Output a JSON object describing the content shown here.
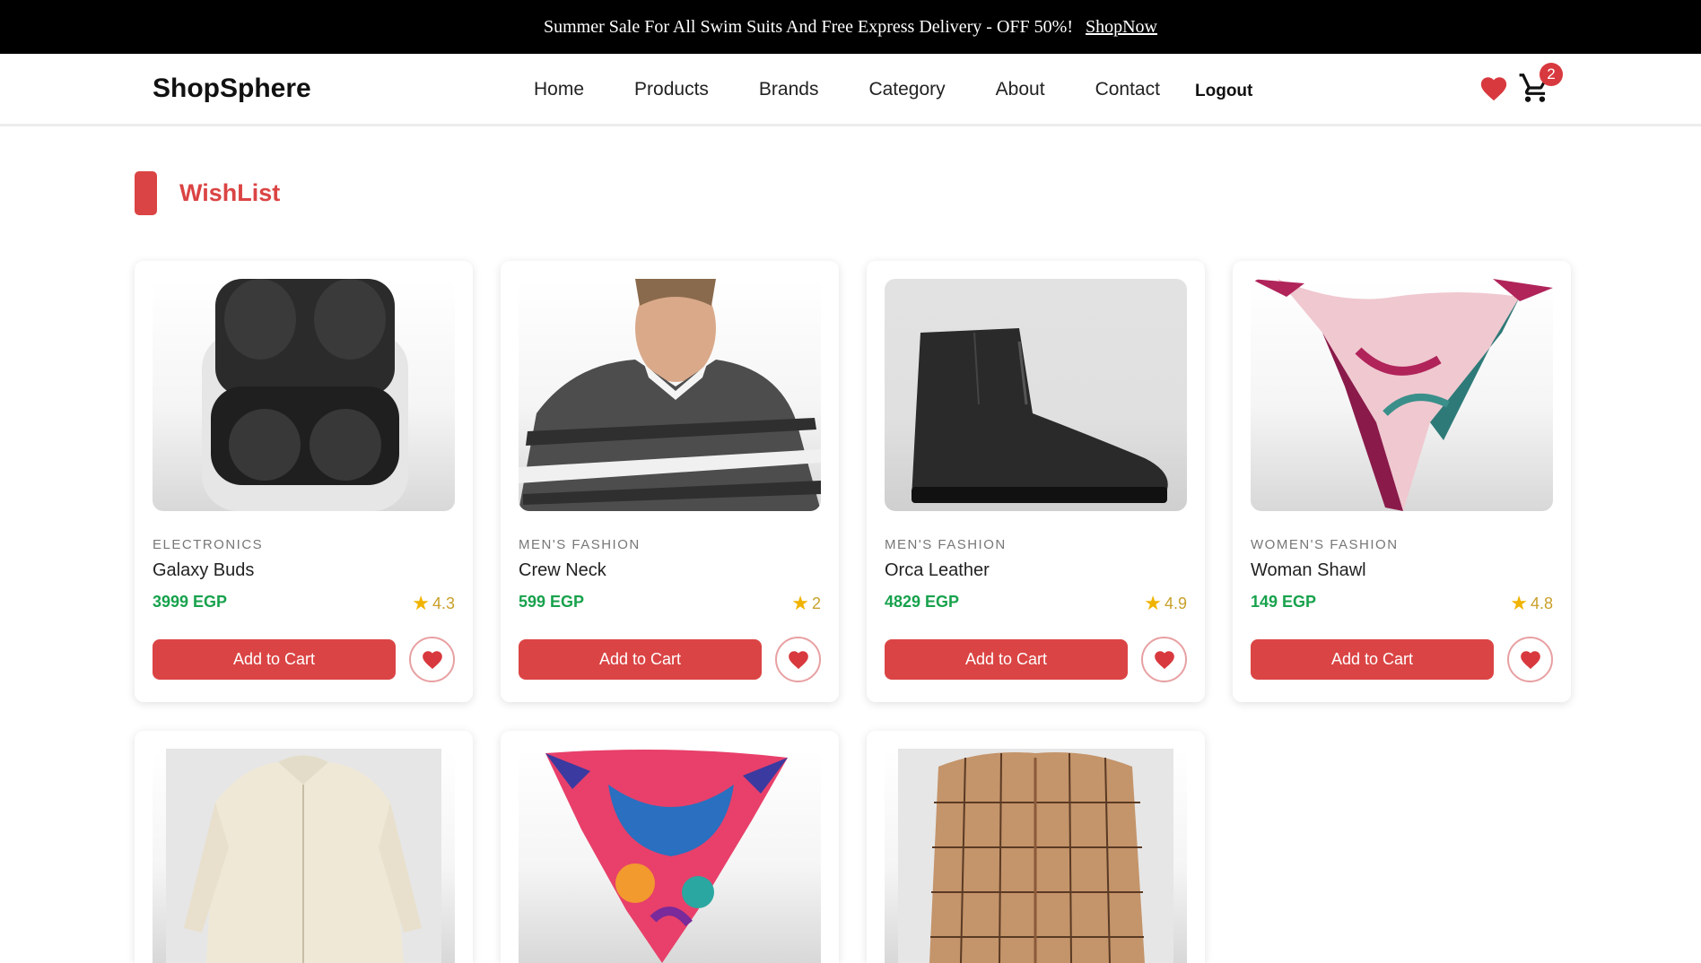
{
  "promo": {
    "text": "Summer Sale For All Swim Suits And Free Express Delivery - OFF 50%!",
    "link": "ShopNow"
  },
  "nav": {
    "brand": "ShopSphere",
    "links": [
      "Home",
      "Products",
      "Brands",
      "Category",
      "About",
      "Contact"
    ],
    "logout": "Logout",
    "cart_count": "2"
  },
  "wishlist": {
    "title": "WishList",
    "button_label": "Add to Cart",
    "items": [
      {
        "category": "ELECTRONICS",
        "name": "Galaxy Buds",
        "price": "3999 EGP",
        "rating": "4.3",
        "image": "earbuds-case"
      },
      {
        "category": "MEN'S FASHION",
        "name": "Crew Neck",
        "price": "599 EGP",
        "rating": "2",
        "image": "striped-sweater"
      },
      {
        "category": "MEN'S FASHION",
        "name": "Orca Leather",
        "price": "4829 EGP",
        "rating": "4.9",
        "image": "leather-boot"
      },
      {
        "category": "WOMEN'S FASHION",
        "name": "Woman Shawl",
        "price": "149 EGP",
        "rating": "4.8",
        "image": "silk-shawl"
      },
      {
        "image": "cream-zip-jacket"
      },
      {
        "image": "colorful-scarf"
      },
      {
        "image": "plaid-shirt"
      }
    ]
  },
  "colors": {
    "accent": "#db4444",
    "price": "#18a24d",
    "star": "#f0b400"
  }
}
